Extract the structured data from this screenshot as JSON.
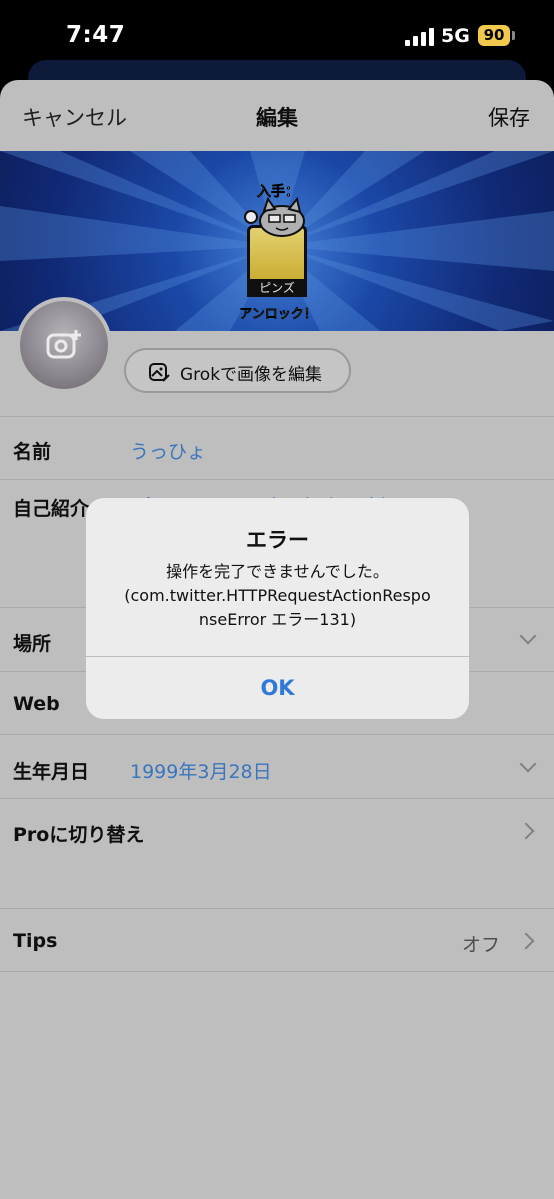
{
  "status_bar": {
    "time": "7:47",
    "network": "5G",
    "battery": "90"
  },
  "nav": {
    "cancel": "キャンセル",
    "title": "編集",
    "save": "保存"
  },
  "banner": {
    "top_text": "入手：",
    "card_label": "ピンズ",
    "bottom_text": "アンロック！"
  },
  "grok_button": {
    "label": "Grokで画像を編集"
  },
  "rows": {
    "name": {
      "label": "名前",
      "value": "うっひょ"
    },
    "bio": {
      "label": "自己紹介",
      "peek": "プロフィールに自己紹介を追加する"
    },
    "location": {
      "label": "場所"
    },
    "web": {
      "label": "Web"
    },
    "birthday": {
      "label": "生年月日",
      "value": "1999年3月28日"
    },
    "pro": {
      "label": "Proに切り替え"
    },
    "tips": {
      "label": "Tips",
      "value": "オフ"
    }
  },
  "alert": {
    "title": "エラー",
    "message_line1": "操作を完了できませんでした。",
    "message_line2": "(com.twitter.HTTPRequestActionRespo",
    "message_line3": "nseError エラー131)",
    "ok": "OK"
  },
  "colors": {
    "accent": "#2f79d8",
    "link": "#3f7fcf",
    "battery": "#f2c94c",
    "banner": "#1e4fb6"
  }
}
